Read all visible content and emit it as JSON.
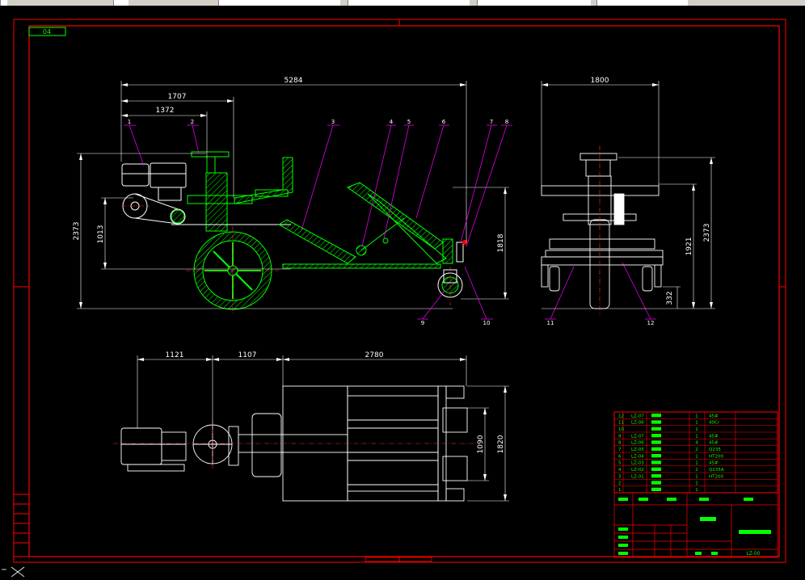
{
  "sheet_tag": "04",
  "overall_dims": {
    "total_length": "5284",
    "d1707": "1707",
    "d1372": "1372",
    "height": "2373",
    "d1013": "1013",
    "d1818": "1818"
  },
  "side_view_dims": {
    "width": "1800",
    "d1921": "1921",
    "height": "2373",
    "d332": "332"
  },
  "plan_view_dims": {
    "d1121": "1121",
    "d1107": "1107",
    "d2780": "2780",
    "d1090": "1090",
    "d1820": "1820"
  },
  "balloons": {
    "b1": "1",
    "b2": "2",
    "b3": "3",
    "b4": "4",
    "b5": "5",
    "b6": "6",
    "b7": "7",
    "b8": "8",
    "b9": "9",
    "b10": "10",
    "b11": "11",
    "b12": "12"
  },
  "bom": {
    "rows": [
      {
        "no": "12",
        "code": "LZ-07",
        "qty": "1",
        "mat": "45#"
      },
      {
        "no": "11",
        "code": "LZ-06",
        "qty": "1",
        "mat": "40Cr"
      },
      {
        "no": "10",
        "code": "",
        "qty": "1",
        "mat": ""
      },
      {
        "no": "9",
        "code": "LZ-07",
        "qty": "1",
        "mat": "45#"
      },
      {
        "no": "8",
        "code": "LZ-06",
        "qty": "4",
        "mat": "45#"
      },
      {
        "no": "7",
        "code": "LZ-05",
        "qty": "2",
        "mat": "Q235"
      },
      {
        "no": "6",
        "code": "LZ-04",
        "qty": "1",
        "mat": "HT200"
      },
      {
        "no": "5",
        "code": "LZ-03",
        "qty": "1",
        "mat": "45#"
      },
      {
        "no": "4",
        "code": "LZ-02",
        "qty": "2",
        "mat": "Q235A"
      },
      {
        "no": "3",
        "code": "LZ-01",
        "qty": "1",
        "mat": "HT200"
      },
      {
        "no": "2",
        "code": "",
        "qty": "1",
        "mat": ""
      },
      {
        "no": "1",
        "code": "",
        "qty": "1",
        "mat": ""
      }
    ]
  },
  "title_block": {
    "drawing_no": "LZ-00"
  },
  "colors": {
    "frame": "#ff0000",
    "outline": "#ffffff",
    "dimension": "#ffffff",
    "leader": "#ff00ff",
    "hatch": "#00ff00",
    "centerline": "#ff3030",
    "text_green": "#00ff00",
    "text_yellow": "#ffff00"
  }
}
